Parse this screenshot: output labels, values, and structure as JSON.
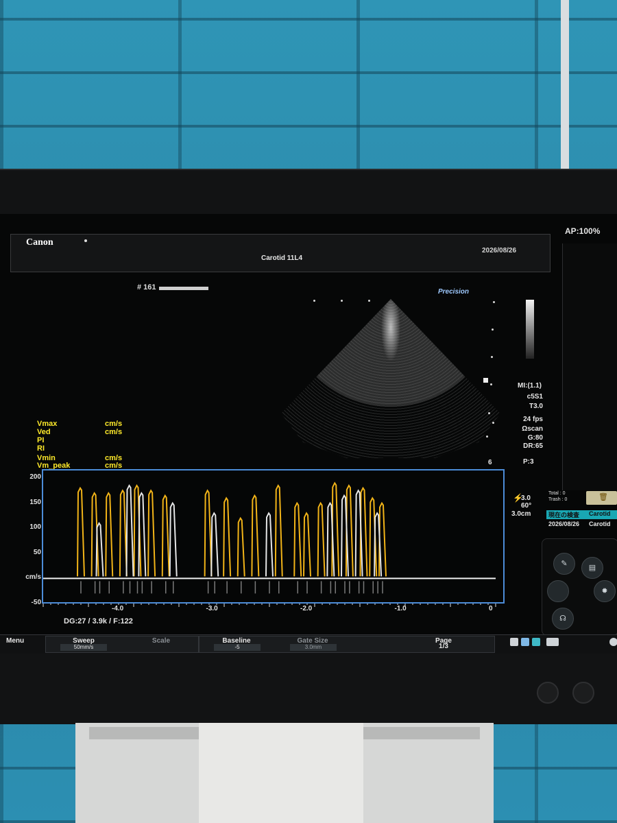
{
  "header": {
    "brand": "Canon",
    "status": "AP:100%",
    "date": "2026/08/26",
    "exam": "Carotid 11L4",
    "image_number": "# 161"
  },
  "bmode": {
    "preset_label": "Precision",
    "params": [
      "MI:(1.1)",
      "c5S1",
      "T3.0",
      "24 fps",
      "Ωscan",
      "G:80",
      "DR:65"
    ],
    "depth_marker": "6",
    "power": "P:3"
  },
  "measurements": [
    {
      "label": "Vmax",
      "unit": "cm/s"
    },
    {
      "label": "Ved",
      "unit": "cm/s"
    },
    {
      "label": "PI",
      "unit": ""
    },
    {
      "label": "RI",
      "unit": ""
    },
    {
      "label": "Vmin",
      "unit": "cm/s"
    },
    {
      "label": "Vm_peak",
      "unit": "cm/s"
    }
  ],
  "doppler": {
    "params": [
      "3.0",
      "60°",
      "3.0cm"
    ],
    "status": "DG:27 / 3.9k   / F:122",
    "y_ticks": [
      "200",
      "150",
      "100",
      "50",
      "cm/s",
      "-50"
    ],
    "x_ticks": [
      "-4.0",
      "-3.0",
      "-2.0",
      "-1.0",
      "0"
    ]
  },
  "chart_data": {
    "type": "line",
    "ylabel": "cm/s",
    "ylim": [
      -50,
      200
    ],
    "xlim": [
      -4.8,
      0
    ],
    "x_ticks": [
      -4.0,
      -3.0,
      -2.0,
      -1.0,
      0
    ],
    "y_ticks": [
      200,
      150,
      100,
      50,
      -50
    ],
    "series": [
      {
        "color": "#f2b418",
        "peaks": [
          {
            "t": -4.4,
            "v": 180
          },
          {
            "t": -4.25,
            "v": 170
          },
          {
            "t": -4.1,
            "v": 170
          },
          {
            "t": -3.95,
            "v": 175
          },
          {
            "t": -3.8,
            "v": 185
          },
          {
            "t": -3.65,
            "v": 175
          },
          {
            "t": -3.5,
            "v": 165
          },
          {
            "t": -3.05,
            "v": 175
          },
          {
            "t": -2.85,
            "v": 160
          },
          {
            "t": -2.7,
            "v": 120
          },
          {
            "t": -2.55,
            "v": 165
          },
          {
            "t": -2.3,
            "v": 185
          },
          {
            "t": -2.1,
            "v": 150
          },
          {
            "t": -2.0,
            "v": 130
          },
          {
            "t": -1.85,
            "v": 150
          },
          {
            "t": -1.7,
            "v": 190
          },
          {
            "t": -1.55,
            "v": 185
          },
          {
            "t": -1.4,
            "v": 180
          },
          {
            "t": -1.3,
            "v": 160
          },
          {
            "t": -1.2,
            "v": 150
          }
        ]
      },
      {
        "color": "#e6e6e6",
        "peaks": [
          {
            "t": -4.2,
            "v": 110
          },
          {
            "t": -3.88,
            "v": 185
          },
          {
            "t": -3.75,
            "v": 170
          },
          {
            "t": -3.42,
            "v": 150
          },
          {
            "t": -2.98,
            "v": 130
          },
          {
            "t": -2.4,
            "v": 130
          },
          {
            "t": -1.75,
            "v": 150
          },
          {
            "t": -1.6,
            "v": 165
          },
          {
            "t": -1.45,
            "v": 175
          },
          {
            "t": -1.25,
            "v": 130
          }
        ]
      }
    ]
  },
  "side_panel": {
    "total": "Total : 0",
    "trash": "Trash : 0",
    "patients": [
      {
        "date": "現在の検査",
        "name": "Carotid"
      },
      {
        "date": "2026/08/26",
        "name": "Carotid"
      }
    ]
  },
  "menubar": {
    "menu": "Menu",
    "sweep_title": "Sweep",
    "sweep_value": "50mm/s",
    "scale_title": "Scale",
    "baseline_title": "Baseline",
    "baseline_value": "-5",
    "gate_title": "Gate Size",
    "gate_value": "3.0mm",
    "page_title": "Page",
    "page_value": "1/3"
  },
  "colors": {
    "measurement_text": "#ffea2a",
    "doppler_frame": "#4c8cd8",
    "spectrum_orange": "#f2b418",
    "highlight_row": "#19a7b3"
  }
}
